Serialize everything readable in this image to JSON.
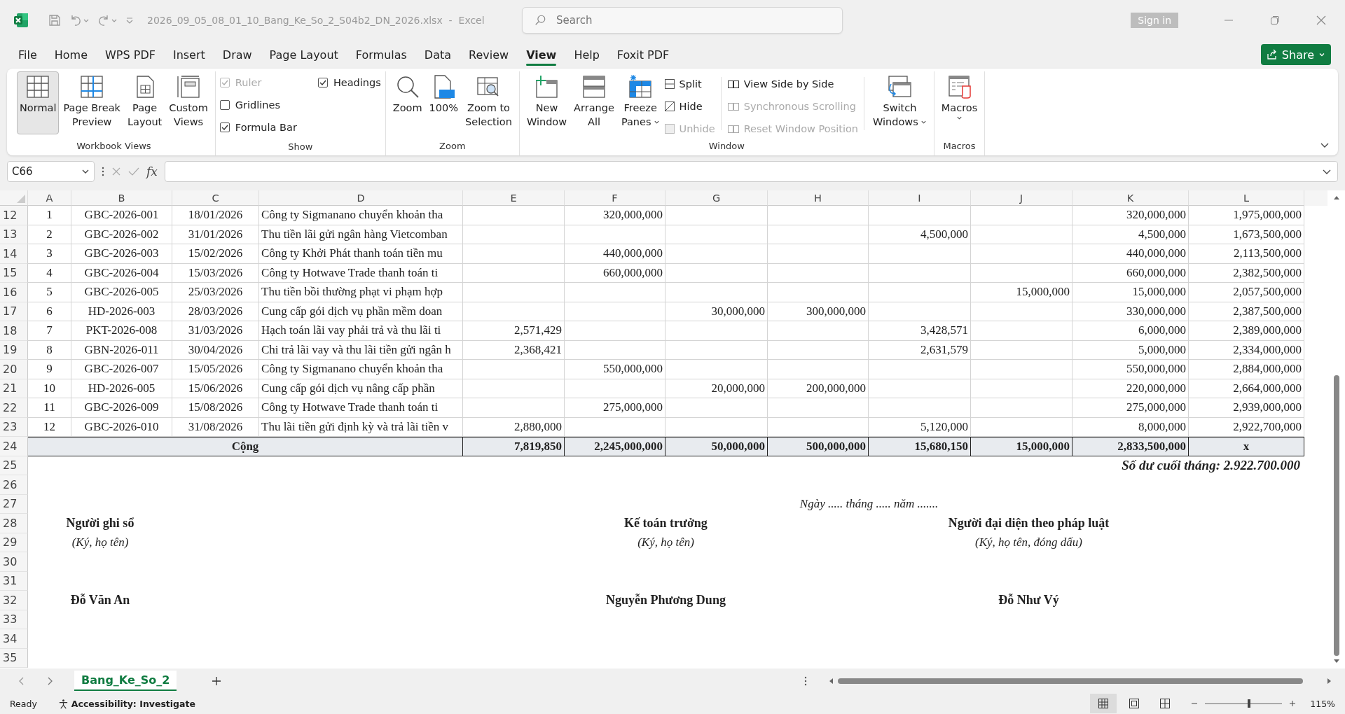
{
  "title_bar": {
    "title": "2026_09_05_08_01_10_Bang_Ke_So_2_S04b2_DN_2026.xlsx  -  Excel",
    "search_placeholder": "Search",
    "sign_in": "Sign in"
  },
  "menu_tabs": [
    {
      "label": "File",
      "selected": false
    },
    {
      "label": "Home",
      "selected": false
    },
    {
      "label": "WPS PDF",
      "selected": false
    },
    {
      "label": "Insert",
      "selected": false
    },
    {
      "label": "Draw",
      "selected": false
    },
    {
      "label": "Page Layout",
      "selected": false
    },
    {
      "label": "Formulas",
      "selected": false
    },
    {
      "label": "Data",
      "selected": false
    },
    {
      "label": "Review",
      "selected": false
    },
    {
      "label": "View",
      "selected": true
    },
    {
      "label": "Help",
      "selected": false
    },
    {
      "label": "Foxit PDF",
      "selected": false
    }
  ],
  "share_button": "Share",
  "ribbon": {
    "groups": [
      {
        "kind": "views",
        "label": "Workbook Views",
        "items": [
          {
            "label": "Normal",
            "selected": true
          },
          {
            "label": "Page Break\nPreview",
            "selected": false
          },
          {
            "label": "Page\nLayout",
            "selected": false
          },
          {
            "label": "Custom\nViews",
            "selected": false
          }
        ]
      },
      {
        "kind": "show",
        "label": "Show",
        "items": [
          {
            "label": "Ruler",
            "checked": true,
            "disabled": true
          },
          {
            "label": "Gridlines",
            "checked": false,
            "disabled": false
          },
          {
            "label": "Formula Bar",
            "checked": true,
            "disabled": false
          },
          {
            "label": "Headings",
            "checked": true,
            "disabled": false
          }
        ]
      },
      {
        "kind": "zoom",
        "label": "Zoom",
        "items": [
          {
            "label": "Zoom"
          },
          {
            "label": "100%"
          },
          {
            "label": "Zoom to\nSelection"
          }
        ]
      },
      {
        "kind": "window",
        "label": "Window",
        "big": [
          {
            "label": "New\nWindow",
            "dropdown": false
          },
          {
            "label": "Arrange\nAll",
            "dropdown": false
          },
          {
            "label": "Freeze\nPanes",
            "dropdown": true
          }
        ],
        "small": [
          {
            "label": "Split",
            "disabled": false
          },
          {
            "label": "Hide",
            "disabled": false
          },
          {
            "label": "Unhide",
            "disabled": true
          },
          {
            "label": "View Side by Side",
            "disabled": false
          },
          {
            "label": "Synchronous Scrolling",
            "disabled": true
          },
          {
            "label": "Reset Window Position",
            "disabled": true
          }
        ],
        "switch": {
          "label": "Switch\nWindows",
          "dropdown": true
        }
      },
      {
        "kind": "macros",
        "label": "Macros",
        "items": [
          {
            "label": "Macros",
            "dropdown": true
          }
        ]
      }
    ]
  },
  "formula_bar": {
    "name_box": "C66",
    "fx": "fx"
  },
  "columns": [
    "A",
    "B",
    "C",
    "D",
    "E",
    "F",
    "G",
    "H",
    "I",
    "J",
    "K",
    "L"
  ],
  "rows": [
    {
      "row": "12",
      "A": "1",
      "B": "GBC-2026-001",
      "C": "18/01/2026",
      "D": "Công ty Sigmanano chuyển khoản tha",
      "F": "320,000,000",
      "K": "320,000,000",
      "L": "1,975,000,000"
    },
    {
      "row": "13",
      "A": "2",
      "B": "GBC-2026-002",
      "C": "31/01/2026",
      "D": "Thu tiền lãi gửi ngân hàng Vietcomban",
      "I": "4,500,000",
      "K": "4,500,000",
      "L": "1,673,500,000"
    },
    {
      "row": "14",
      "A": "3",
      "B": "GBC-2026-003",
      "C": "15/02/2026",
      "D": "Công ty Khởi Phát thanh toán tiền mu",
      "F": "440,000,000",
      "K": "440,000,000",
      "L": "2,113,500,000"
    },
    {
      "row": "15",
      "A": "4",
      "B": "GBC-2026-004",
      "C": "15/03/2026",
      "D": "Công ty Hotwave Trade thanh toán ti",
      "F": "660,000,000",
      "K": "660,000,000",
      "L": "2,382,500,000"
    },
    {
      "row": "16",
      "A": "5",
      "B": "GBC-2026-005",
      "C": "25/03/2026",
      "D": "Thu tiền bồi thường phạt vi phạm hợp",
      "J": "15,000,000",
      "K": "15,000,000",
      "L": "2,057,500,000"
    },
    {
      "row": "17",
      "A": "6",
      "B": "HD-2026-003",
      "C": "28/03/2026",
      "D": "Cung cấp gói dịch vụ phần mềm doan",
      "G": "30,000,000",
      "H": "300,000,000",
      "K": "330,000,000",
      "L": "2,387,500,000"
    },
    {
      "row": "18",
      "A": "7",
      "B": "PKT-2026-008",
      "C": "31/03/2026",
      "D": "Hạch toán lãi vay phải trả và thu lãi ti",
      "E": "2,571,429",
      "I": "3,428,571",
      "K": "6,000,000",
      "L": "2,389,000,000"
    },
    {
      "row": "19",
      "A": "8",
      "B": "GBN-2026-011",
      "C": "30/04/2026",
      "D": "Chi trả lãi vay và thu lãi tiền gửi ngân h",
      "E": "2,368,421",
      "I": "2,631,579",
      "K": "5,000,000",
      "L": "2,334,000,000"
    },
    {
      "row": "20",
      "A": "9",
      "B": "GBC-2026-007",
      "C": "15/05/2026",
      "D": "Công ty Sigmanano chuyển khoản tha",
      "F": "550,000,000",
      "K": "550,000,000",
      "L": "2,884,000,000"
    },
    {
      "row": "21",
      "A": "10",
      "B": "HD-2026-005",
      "C": "15/06/2026",
      "D": "Cung cấp gói dịch vụ nâng cấp phần",
      "G": "20,000,000",
      "H": "200,000,000",
      "K": "220,000,000",
      "L": "2,664,000,000"
    },
    {
      "row": "22",
      "A": "11",
      "B": "GBC-2026-009",
      "C": "15/08/2026",
      "D": "Công ty Hotwave Trade thanh toán ti",
      "F": "275,000,000",
      "K": "275,000,000",
      "L": "2,939,000,000"
    },
    {
      "row": "23",
      "A": "12",
      "B": "GBC-2026-010",
      "C": "31/08/2026",
      "D": "Thu lãi tiền gửi định kỳ và trả lãi tiền v",
      "E": "2,880,000",
      "I": "5,120,000",
      "K": "8,000,000",
      "L": "2,922,700,000"
    }
  ],
  "total_row": {
    "row": "24",
    "label": "Cộng",
    "E": "7,819,850",
    "F": "2,245,000,000",
    "G": "50,000,000",
    "H": "500,000,000",
    "I": "15,680,150",
    "J": "15,000,000",
    "K": "2,833,500,000",
    "L": "x"
  },
  "footer_rows": [
    {
      "row": "25",
      "texts": [
        {
          "kind": "balance",
          "text": "Số dư cuối tháng: 2.922.700.000"
        }
      ]
    },
    {
      "row": "26",
      "texts": []
    },
    {
      "row": "27",
      "texts": [
        {
          "kind": "date",
          "text": "Ngày ..... tháng ..... năm ......."
        }
      ]
    },
    {
      "row": "28",
      "texts": [
        {
          "kind": "title",
          "text": "Người ghi sổ"
        },
        {
          "kind": "title",
          "text": "Kế toán trưởng"
        },
        {
          "kind": "title",
          "text": "Người đại diện theo pháp luật"
        }
      ]
    },
    {
      "row": "29",
      "texts": [
        {
          "kind": "hint",
          "text": "(Ký, họ tên)"
        },
        {
          "kind": "hint",
          "text": "(Ký, họ tên)"
        },
        {
          "kind": "hint",
          "text": "(Ký, họ tên, đóng dấu)"
        }
      ]
    },
    {
      "row": "30",
      "texts": []
    },
    {
      "row": "31",
      "texts": []
    },
    {
      "row": "32",
      "texts": [
        {
          "kind": "name",
          "text": "Đỗ Văn An"
        },
        {
          "kind": "name",
          "text": "Nguyễn Phương Dung"
        },
        {
          "kind": "name",
          "text": "Đỗ Như Vý"
        }
      ]
    },
    {
      "row": "33",
      "texts": []
    },
    {
      "row": "34",
      "texts": []
    },
    {
      "row": "35",
      "texts": []
    }
  ],
  "sheet_tabs": [
    {
      "label": "Bang_Ke_So_2",
      "selected": true
    }
  ],
  "status_bar": {
    "ready": "Ready",
    "accessibility": "Accessibility: Investigate",
    "zoom": "115%",
    "zoom_level": {
      "level": 0.57
    }
  }
}
